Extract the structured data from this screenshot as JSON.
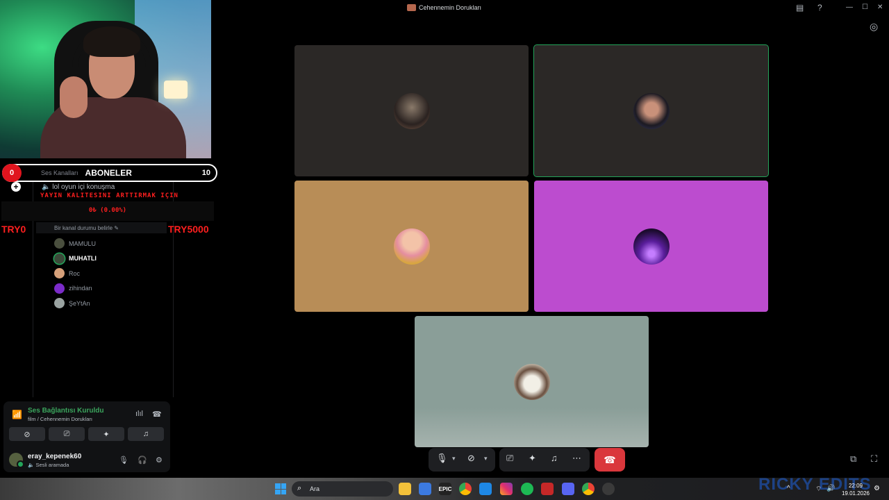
{
  "window": {
    "title": "Cehennemin Dorukları"
  },
  "overlay": {
    "sub_count_current": "0",
    "sub_label_small": "Ses Kanalları",
    "sub_label": "ABONELER",
    "sub_goal": "10",
    "quality_text": "YAYIN KALITESINI ARTTIRMAK IÇIN",
    "goal_progress": "0₺ (0.00%)",
    "donation_min": "TRY0",
    "donation_max": "TRY5000"
  },
  "sidebar": {
    "voice_channel": "lol oyun içi konuşma",
    "channel_status_placeholder": "Bir kanal durumu belirle",
    "members": [
      {
        "name": "MAMULU",
        "color": "#4a4f3e",
        "speaking": false
      },
      {
        "name": "MUHATLI",
        "color": "#3c4a3a",
        "speaking": true
      },
      {
        "name": "Roc",
        "color": "#d6a07a",
        "speaking": false
      },
      {
        "name": "zihindan",
        "color": "#7b2bc9",
        "speaking": false
      },
      {
        "name": "ŞeYtAn",
        "color": "#9aa3a1",
        "speaking": false
      }
    ]
  },
  "voice_panel": {
    "status": "Ses Bağlantısı Kuruldu",
    "channel_path": "film / Cehennemin Dorukları",
    "username": "eray_kepenek60",
    "user_status": "Sesli aramada"
  },
  "tiles": [
    {
      "bg": "#2b2826",
      "avatar": "#5b4a3c",
      "speaking": false
    },
    {
      "bg": "#2b2826",
      "avatar": "#6b4d40",
      "speaking": true
    },
    {
      "bg": "#b88d57",
      "avatar": "#e8a98a",
      "speaking": false
    },
    {
      "bg": "#bc4ccf",
      "avatar": "#4a1a78",
      "speaking": false
    },
    {
      "bg": "#8a9e98",
      "avatar": "#c9c6b8",
      "speaking": false
    }
  ],
  "taskbar": {
    "search_placeholder": "Ara",
    "time": "22:09",
    "date": "19.01.2026",
    "watermark": "RICKY EDITS"
  },
  "colors": {
    "accent_green": "#23a55a",
    "hangup_red": "#da373c",
    "overlay_red": "#ff1f1f"
  }
}
